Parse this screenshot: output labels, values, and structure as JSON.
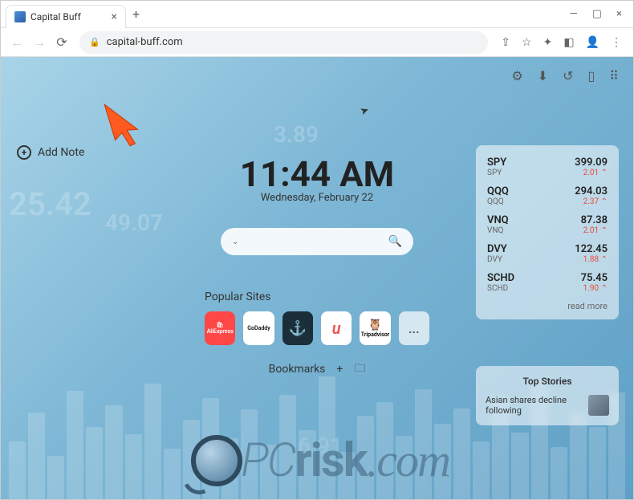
{
  "browser": {
    "tab_title": "Capital Buff",
    "url": "capital-buff.com"
  },
  "add_note_label": "Add Note",
  "clock": {
    "time": "11:44 AM",
    "date": "Wednesday, February 22"
  },
  "popular_sites": {
    "title": "Popular Sites",
    "tiles": [
      "AliExpress",
      "GoDaddy",
      "Shield",
      "u",
      "Tripadvisor",
      "..."
    ]
  },
  "bookmarks_label": "Bookmarks",
  "stocks": [
    {
      "symbol": "SPY",
      "sub": "SPY",
      "price": "399.09",
      "change": "2.01 ⌃"
    },
    {
      "symbol": "QQQ",
      "sub": "QQQ",
      "price": "294.03",
      "change": "2.37 ⌃"
    },
    {
      "symbol": "VNQ",
      "sub": "VNQ",
      "price": "87.38",
      "change": "2.01 ⌃"
    },
    {
      "symbol": "DVY",
      "sub": "DVY",
      "price": "122.45",
      "change": "1.88 ⌃"
    },
    {
      "symbol": "SCHD",
      "sub": "SCHD",
      "price": "75.45",
      "change": "1.90 ⌃"
    }
  ],
  "read_more": "read more",
  "top_stories": {
    "title": "Top Stories",
    "headline": "Asian shares decline following"
  },
  "watermark": "PCrisk.com",
  "bg_numbers": [
    "3.89",
    "25.42",
    "49.07",
    "6.91"
  ]
}
